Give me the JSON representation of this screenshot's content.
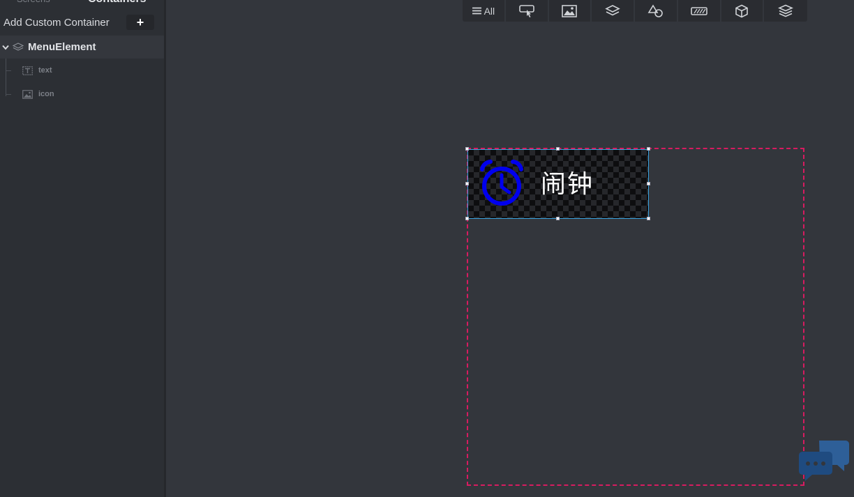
{
  "panel": {
    "tabs": [
      {
        "label": "Screens"
      },
      {
        "label": "Containers"
      }
    ],
    "add_custom_container_label": "Add Custom Container",
    "add_button_label": "+",
    "tree": {
      "root_label": "MenuElement",
      "children": [
        {
          "label": "text",
          "icon": "text-box-icon"
        },
        {
          "label": "icon",
          "icon": "image-icon"
        }
      ]
    }
  },
  "toolbar": {
    "all_label": "All",
    "buttons": [
      "interaction-icon",
      "image-icon",
      "layers-icon",
      "shapes-icon",
      "keyboard-icon",
      "cube-icon",
      "stack-icon"
    ]
  },
  "canvas": {
    "menu_element_text": "闹钟",
    "menu_element_icon": "alarm-clock-icon",
    "colors": {
      "selection": "#3aa3e0",
      "container_outline": "#d81b60",
      "icon": "#0000ee"
    }
  }
}
